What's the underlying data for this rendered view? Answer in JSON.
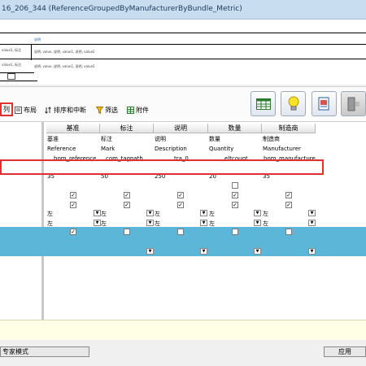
{
  "window": {
    "title": "16_206_344 (ReferenceGroupedByManufacturerByBundle_Metric)"
  },
  "preview": {
    "cell_a": "说明",
    "label_1": "value1, 标注",
    "values_1": "说明, value, 说明, value1, 说明, value2",
    "label_2": "value1, 标注",
    "values_2": "说明, value, 说明, value1, 说明, value2"
  },
  "toolbar": {
    "columns_label": "列",
    "layout_label": "布局",
    "sort_label": "排序和中断",
    "filter_label": "筛选",
    "attach_label": "附件"
  },
  "columns": [
    {
      "header": "基准",
      "label": "基准",
      "field": "Reference",
      "cell": "bom_reference",
      "width": "35",
      "chk1": true,
      "chk2": true,
      "align1": "左",
      "align2": "左"
    },
    {
      "header": "标注",
      "label": "标注",
      "field": "Mark",
      "cell": "com_tagpath",
      "width": "50",
      "chk1": true,
      "chk2": true,
      "align1": "左",
      "align2": "左"
    },
    {
      "header": "说明",
      "label": "说明",
      "field": "Description",
      "cell": "tra_0",
      "width": "250",
      "chk1": true,
      "chk2": true,
      "align1": "左",
      "align2": "左"
    },
    {
      "header": "数量",
      "label": "数量",
      "field": "Quantity",
      "cell": "eltcount",
      "width": "20",
      "chk1": true,
      "chk2": true,
      "align1": "左",
      "align2": "左"
    },
    {
      "header": "制造商",
      "label": "制造商",
      "field": "Manufacturer",
      "cell": "bom_manufacturer",
      "width": "35",
      "chk1": true,
      "chk2": true,
      "align1": "左",
      "align2": "左"
    }
  ],
  "status": {
    "mode_label": "专家模式",
    "apply_label": "应用"
  },
  "colors": {
    "selection_row": "#5bb6d8",
    "highlight_border": "#e03030",
    "title_bar": "#c9ddf1"
  }
}
